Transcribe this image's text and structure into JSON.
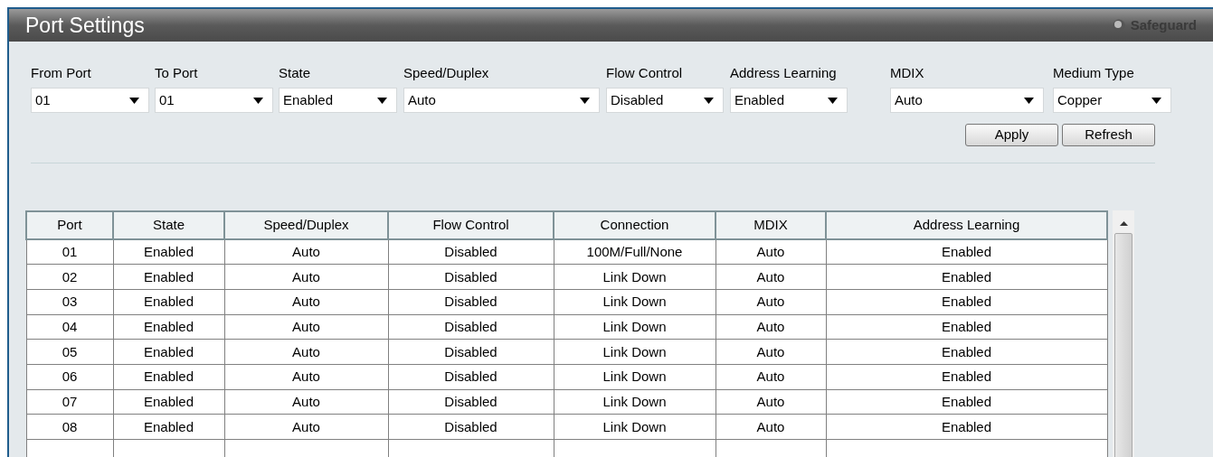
{
  "window": {
    "title": "Port Settings",
    "badge": "Safeguard"
  },
  "filters": [
    {
      "label": "From Port",
      "value": "01"
    },
    {
      "label": "To Port",
      "value": "01"
    },
    {
      "label": "State",
      "value": "Enabled"
    },
    {
      "label": "Speed/Duplex",
      "value": "Auto"
    },
    {
      "label": "Flow Control",
      "value": "Disabled"
    },
    {
      "label": "Address Learning",
      "value": "Enabled"
    },
    {
      "label": "MDIX",
      "value": "Auto"
    },
    {
      "label": "Medium Type",
      "value": "Copper"
    }
  ],
  "buttons": [
    "Apply",
    "Refresh"
  ],
  "table": {
    "columns": [
      "Port",
      "State",
      "Speed/Duplex",
      "Flow Control",
      "Connection",
      "MDIX",
      "Address Learning"
    ],
    "rows": [
      [
        "01",
        "Enabled",
        "Auto",
        "Disabled",
        "100M/Full/None",
        "Auto",
        "Enabled"
      ],
      [
        "02",
        "Enabled",
        "Auto",
        "Disabled",
        "Link Down",
        "Auto",
        "Enabled"
      ],
      [
        "03",
        "Enabled",
        "Auto",
        "Disabled",
        "Link Down",
        "Auto",
        "Enabled"
      ],
      [
        "04",
        "Enabled",
        "Auto",
        "Disabled",
        "Link Down",
        "Auto",
        "Enabled"
      ],
      [
        "05",
        "Enabled",
        "Auto",
        "Disabled",
        "Link Down",
        "Auto",
        "Enabled"
      ],
      [
        "06",
        "Enabled",
        "Auto",
        "Disabled",
        "Link Down",
        "Auto",
        "Enabled"
      ],
      [
        "07",
        "Enabled",
        "Auto",
        "Disabled",
        "Link Down",
        "Auto",
        "Enabled"
      ],
      [
        "08",
        "Enabled",
        "Auto",
        "Disabled",
        "Link Down",
        "Auto",
        "Enabled"
      ]
    ]
  }
}
